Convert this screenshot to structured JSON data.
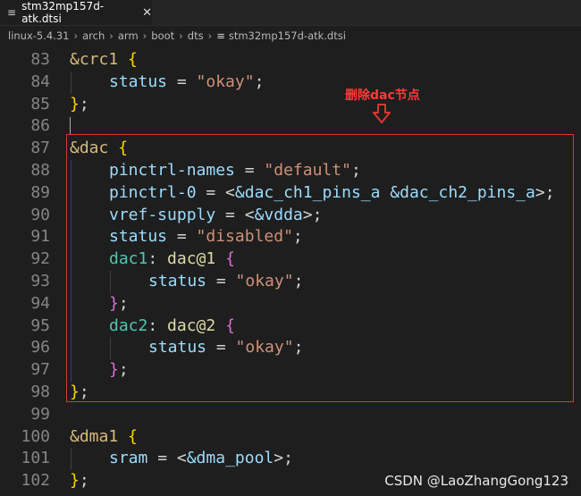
{
  "tab": {
    "title": "stm32mp157d-atk.dtsi",
    "file_icon": "lines-file-icon",
    "close_glyph": "✕"
  },
  "breadcrumb": {
    "items": [
      "linux-5.4.31",
      "arch",
      "arm",
      "boot",
      "dts"
    ],
    "file": "stm32mp157d-atk.dtsi",
    "separator": "›"
  },
  "editor": {
    "lines": [
      {
        "n": "83",
        "indent": 0,
        "tokens": [
          {
            "t": "&crc1 ",
            "c": "sel"
          },
          {
            "t": "{",
            "c": "brace"
          }
        ]
      },
      {
        "n": "84",
        "indent": 1,
        "tokens": [
          {
            "t": "status",
            "c": "prop"
          },
          {
            "t": " = ",
            "c": "plain"
          },
          {
            "t": "\"okay\"",
            "c": "str"
          },
          {
            "t": ";",
            "c": "plain"
          }
        ]
      },
      {
        "n": "85",
        "indent": 0,
        "tokens": [
          {
            "t": "}",
            "c": "brace"
          },
          {
            "t": ";",
            "c": "plain"
          }
        ]
      },
      {
        "n": "86",
        "indent": 0,
        "tokens": []
      },
      {
        "n": "87",
        "indent": 0,
        "tokens": [
          {
            "t": "&dac ",
            "c": "sel"
          },
          {
            "t": "{",
            "c": "brace"
          }
        ]
      },
      {
        "n": "88",
        "indent": 1,
        "tokens": [
          {
            "t": "pinctrl-names",
            "c": "prop"
          },
          {
            "t": " = ",
            "c": "plain"
          },
          {
            "t": "\"default\"",
            "c": "str"
          },
          {
            "t": ";",
            "c": "plain"
          }
        ]
      },
      {
        "n": "89",
        "indent": 1,
        "tokens": [
          {
            "t": "pinctrl-0",
            "c": "prop"
          },
          {
            "t": " = <",
            "c": "plain"
          },
          {
            "t": "&dac_ch1_pins_a &dac_ch2_pins_a",
            "c": "prop"
          },
          {
            "t": ">;",
            "c": "plain"
          }
        ]
      },
      {
        "n": "90",
        "indent": 1,
        "tokens": [
          {
            "t": "vref-supply",
            "c": "prop"
          },
          {
            "t": " = <",
            "c": "plain"
          },
          {
            "t": "&vdda",
            "c": "prop"
          },
          {
            "t": ">;",
            "c": "plain"
          }
        ]
      },
      {
        "n": "91",
        "indent": 1,
        "tokens": [
          {
            "t": "status",
            "c": "prop"
          },
          {
            "t": " = ",
            "c": "plain"
          },
          {
            "t": "\"disabled\"",
            "c": "str"
          },
          {
            "t": ";",
            "c": "plain"
          }
        ]
      },
      {
        "n": "92",
        "indent": 1,
        "tokens": [
          {
            "t": "dac1",
            "c": "label"
          },
          {
            "t": ": ",
            "c": "plain"
          },
          {
            "t": "dac@1 ",
            "c": "node"
          },
          {
            "t": "{",
            "c": "brace2"
          }
        ]
      },
      {
        "n": "93",
        "indent": 2,
        "tokens": [
          {
            "t": "status",
            "c": "prop"
          },
          {
            "t": " = ",
            "c": "plain"
          },
          {
            "t": "\"okay\"",
            "c": "str"
          },
          {
            "t": ";",
            "c": "plain"
          }
        ]
      },
      {
        "n": "94",
        "indent": 1,
        "tokens": [
          {
            "t": "}",
            "c": "brace2"
          },
          {
            "t": ";",
            "c": "plain"
          }
        ]
      },
      {
        "n": "95",
        "indent": 1,
        "tokens": [
          {
            "t": "dac2",
            "c": "label"
          },
          {
            "t": ": ",
            "c": "plain"
          },
          {
            "t": "dac@2 ",
            "c": "node"
          },
          {
            "t": "{",
            "c": "brace2"
          }
        ]
      },
      {
        "n": "96",
        "indent": 2,
        "tokens": [
          {
            "t": "status",
            "c": "prop"
          },
          {
            "t": " = ",
            "c": "plain"
          },
          {
            "t": "\"okay\"",
            "c": "str"
          },
          {
            "t": ";",
            "c": "plain"
          }
        ]
      },
      {
        "n": "97",
        "indent": 1,
        "tokens": [
          {
            "t": "}",
            "c": "brace2"
          },
          {
            "t": ";",
            "c": "plain"
          }
        ]
      },
      {
        "n": "98",
        "indent": 0,
        "tokens": [
          {
            "t": "}",
            "c": "brace"
          },
          {
            "t": ";",
            "c": "plain"
          }
        ]
      },
      {
        "n": "99",
        "indent": 0,
        "tokens": []
      },
      {
        "n": "100",
        "indent": 0,
        "tokens": [
          {
            "t": "&dma1 ",
            "c": "sel"
          },
          {
            "t": "{",
            "c": "brace"
          }
        ]
      },
      {
        "n": "101",
        "indent": 1,
        "tokens": [
          {
            "t": "sram",
            "c": "prop"
          },
          {
            "t": " = <",
            "c": "plain"
          },
          {
            "t": "&dma_pool",
            "c": "prop"
          },
          {
            "t": ">;",
            "c": "plain"
          }
        ]
      },
      {
        "n": "102",
        "indent": 0,
        "tokens": [
          {
            "t": "}",
            "c": "brace"
          },
          {
            "t": ";",
            "c": "plain"
          }
        ]
      }
    ]
  },
  "annotation": {
    "text": "删除dac节点",
    "arrow_icon": "hollow-down-arrow-icon",
    "color": "#e0342f"
  },
  "watermark": "CSDN @LaoZhangGong123",
  "colors": {
    "background": "#1e1e1e",
    "selector": "#d7ba7d",
    "property": "#9cdcfe",
    "string": "#ce9178",
    "label": "#4ec9b0",
    "node": "#dcdcaa",
    "brace_level1": "#ffd700",
    "brace_level2": "#da70d6"
  }
}
